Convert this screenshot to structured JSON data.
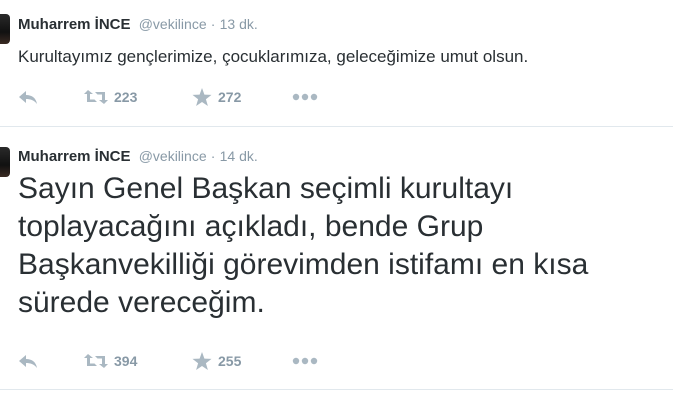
{
  "tweets": [
    {
      "fullname": "Muharrem İNCE",
      "username": "@vekilince",
      "separator": "·",
      "time": "13 dk.",
      "text": "Kurultayımız gençlerimize, çocuklarımıza, geleceğimize umut olsun.",
      "retweets": "223",
      "favorites": "272"
    },
    {
      "fullname": "Muharrem İNCE",
      "username": "@vekilince",
      "separator": "·",
      "time": "14 dk.",
      "text": "Sayın Genel Başkan seçimli kurultayı\ntoplayacağını açıkladı, bende Grup\nBaşkanvekilliği görevimden istifamı en kısa\nsürede vereceğim.",
      "retweets": "394",
      "favorites": "255"
    }
  ],
  "icons": {
    "reply": "reply-icon",
    "retweet": "retweet-icon",
    "favorite": "star-icon",
    "more": "more-dots-icon"
  },
  "colors": {
    "text": "#292f33",
    "muted": "#8899a6",
    "divider": "#e1e8ed"
  }
}
